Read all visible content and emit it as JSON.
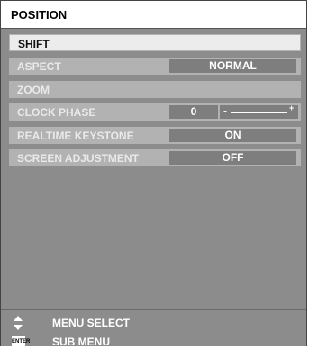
{
  "menu": {
    "title": "POSITION",
    "items": [
      {
        "label": "SHIFT"
      },
      {
        "label": "ASPECT",
        "value": "NORMAL"
      },
      {
        "label": "ZOOM"
      },
      {
        "label": "CLOCK PHASE",
        "value": "0",
        "slider_level": 0.02
      },
      {
        "label": "REALTIME KEYSTONE",
        "value": "ON"
      },
      {
        "label": "SCREEN ADJUSTMENT",
        "value": "OFF"
      }
    ],
    "slider": {
      "minus": "-",
      "plus": "+"
    }
  },
  "footer": {
    "menu_select": "MENU SELECT",
    "sub_menu": "SUB MENU",
    "enter_icon_text": "ENTER",
    "icons": [
      "up-down-arrow-icon",
      "enter-icon"
    ]
  }
}
